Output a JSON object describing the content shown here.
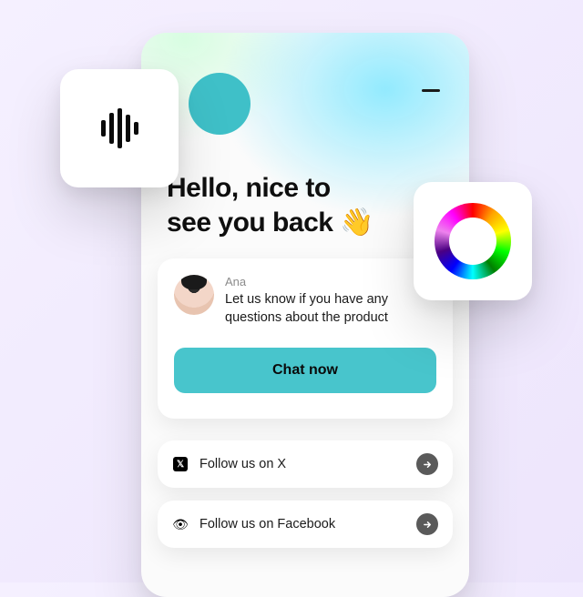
{
  "greeting": {
    "line1": "Hello, nice to",
    "line2": "see you back",
    "emoji": "👋"
  },
  "message": {
    "author": "Ana",
    "text": "Let us know if you have any questions about the product"
  },
  "actions": {
    "chat_button": "Chat now"
  },
  "links": [
    {
      "label": "Follow us on X",
      "icon": "x-logo"
    },
    {
      "label": "Follow us on Facebook",
      "icon": "eye"
    }
  ],
  "float_icons": {
    "left": "audio-waveform",
    "right": "color-wheel"
  }
}
